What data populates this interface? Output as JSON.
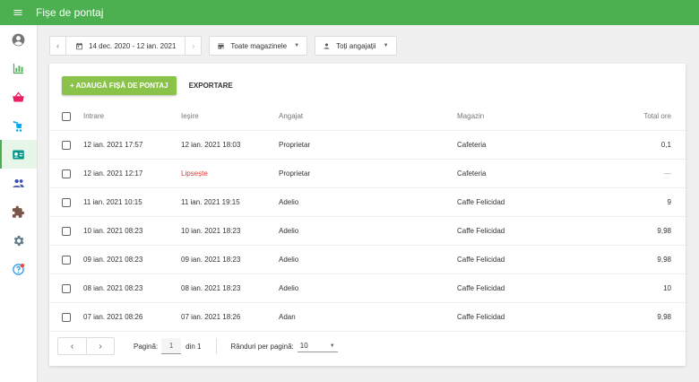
{
  "app": {
    "title": "Fișe de pontaj"
  },
  "filters": {
    "date_range": "14 dec. 2020 - 12 ian. 2021",
    "store": "Toate magazinele",
    "employee": "Toți angajații"
  },
  "actions": {
    "add_label": "+ ADAUGĂ FIȘĂ DE PONTAJ",
    "export_label": "EXPORTARE"
  },
  "table": {
    "headers": {
      "clock_in": "Intrare",
      "clock_out": "Ieșire",
      "employee": "Angajat",
      "store": "Magazin",
      "total": "Total ore"
    },
    "rows": [
      {
        "clock_in": "12 ian. 2021 17:57",
        "clock_out": "12 ian. 2021 18:03",
        "employee": "Proprietar",
        "store": "Cafeteria",
        "total": "0,1"
      },
      {
        "clock_in": "12 ian. 2021 12:17",
        "clock_out": "Lipsește",
        "employee": "Proprietar",
        "store": "Cafeteria",
        "total": "—"
      },
      {
        "clock_in": "11 ian. 2021 10:15",
        "clock_out": "11 ian. 2021 19:15",
        "employee": "Adelio",
        "store": "Caffe Felicidad",
        "total": "9"
      },
      {
        "clock_in": "10 ian. 2021 08:23",
        "clock_out": "10 ian. 2021 18:23",
        "employee": "Adelio",
        "store": "Caffe Felicidad",
        "total": "9,98"
      },
      {
        "clock_in": "09 ian. 2021 08:23",
        "clock_out": "09 ian. 2021 18:23",
        "employee": "Adelio",
        "store": "Caffe Felicidad",
        "total": "9,98"
      },
      {
        "clock_in": "08 ian. 2021 08:23",
        "clock_out": "08 ian. 2021 18:23",
        "employee": "Adelio",
        "store": "Caffe Felicidad",
        "total": "10"
      },
      {
        "clock_in": "07 ian. 2021 08:26",
        "clock_out": "07 ian. 2021 18:26",
        "employee": "Adan",
        "store": "Caffe Felicidad",
        "total": "9,98"
      }
    ]
  },
  "pagination": {
    "page_label": "Pagină:",
    "page": "1",
    "of_label": "din 1",
    "rows_label": "Rânduri per pagină:",
    "rows_value": "10"
  },
  "sidebar": {
    "items": [
      {
        "name": "account-icon"
      },
      {
        "name": "reports-icon"
      },
      {
        "name": "sales-icon"
      },
      {
        "name": "items-icon"
      },
      {
        "name": "employees-icon",
        "active": true
      },
      {
        "name": "customers-icon"
      },
      {
        "name": "integrations-icon"
      },
      {
        "name": "settings-icon"
      },
      {
        "name": "help-icon"
      }
    ]
  },
  "colors": {
    "primary": "#4caf50",
    "button": "#8bc34a",
    "missing": "#e53935"
  }
}
